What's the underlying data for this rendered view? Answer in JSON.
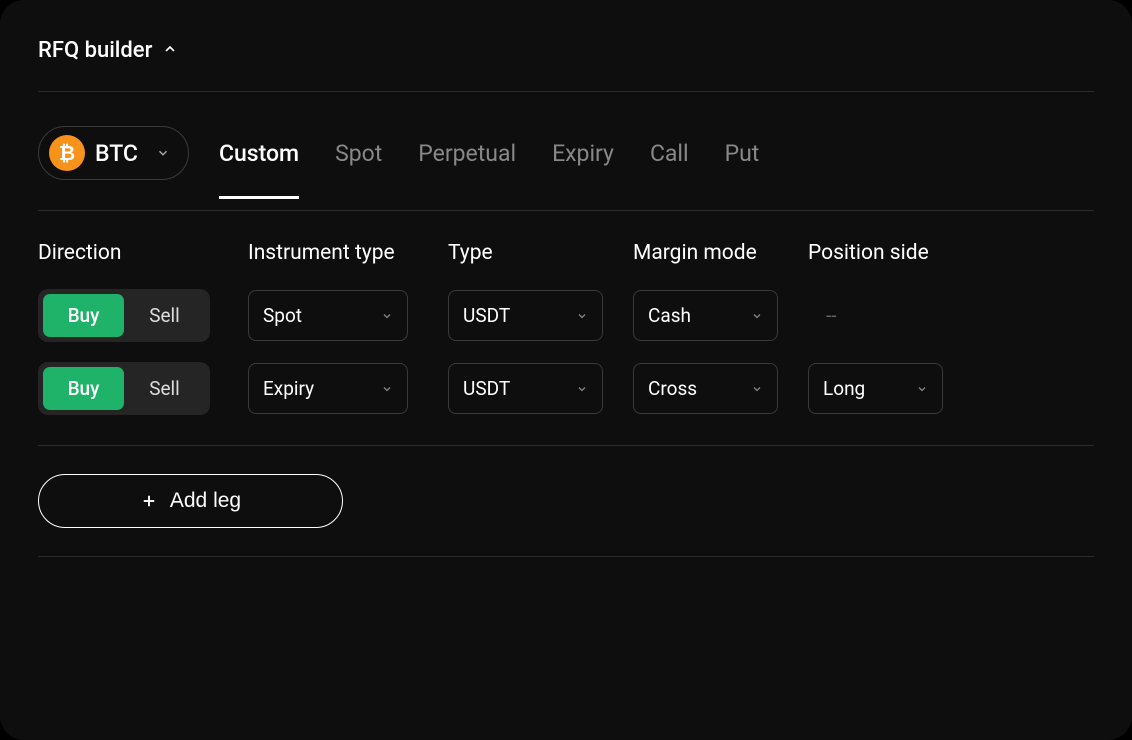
{
  "header": {
    "title": "RFQ builder"
  },
  "asset": {
    "symbol": "BTC",
    "icon_glyph": "₿"
  },
  "tabs": [
    {
      "label": "Custom",
      "active": true
    },
    {
      "label": "Spot",
      "active": false
    },
    {
      "label": "Perpetual",
      "active": false
    },
    {
      "label": "Expiry",
      "active": false
    },
    {
      "label": "Call",
      "active": false
    },
    {
      "label": "Put",
      "active": false
    }
  ],
  "columns": {
    "direction": "Direction",
    "instrument_type": "Instrument type",
    "type": "Type",
    "margin_mode": "Margin mode",
    "position_side": "Position side"
  },
  "direction_labels": {
    "buy": "Buy",
    "sell": "Sell"
  },
  "legs": [
    {
      "direction": "Buy",
      "instrument_type": "Spot",
      "type": "USDT",
      "margin_mode": "Cash",
      "position_side": "--"
    },
    {
      "direction": "Buy",
      "instrument_type": "Expiry",
      "type": "USDT",
      "margin_mode": "Cross",
      "position_side": "Long"
    }
  ],
  "add_leg": {
    "label": "Add leg"
  }
}
